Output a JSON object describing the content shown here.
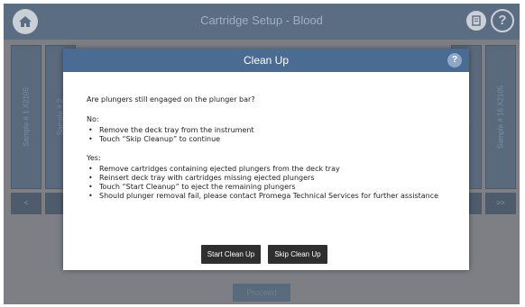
{
  "app": {
    "title": "Cartridge Setup - Blood",
    "proceed_label": "Proceed"
  },
  "icons": {
    "home": "home-icon",
    "notes": "notes-icon",
    "help": "help-icon"
  },
  "lanes": {
    "left": [
      "Sample # 1 X2105",
      "Sample # 2"
    ],
    "right": [
      "Sample # 15",
      "Sample # 16 X2105"
    ],
    "left_buttons": [
      "<",
      ""
    ],
    "right_buttons": [
      "",
      ">>"
    ]
  },
  "dialog": {
    "title": "Clean Up",
    "help_glyph": "?",
    "question": "Are plungers still engaged on the plunger bar?",
    "no_label": "No:",
    "no_items": [
      "Remove the deck tray from the instrument",
      "Touch “Skip Cleanup” to continue"
    ],
    "yes_label": "Yes:",
    "yes_items": [
      "Remove cartridges containing ejected plungers from the deck tray",
      "Reinsert deck tray  with cartridges missing ejected plungers",
      "Touch “Start Cleanup” to eject the remaining plungers",
      "Should plunger removal fail, please contact Promega Technical Services for further assistance"
    ],
    "start_button": "Start Clean Up",
    "skip_button": "Skip Clean Up"
  },
  "colors": {
    "dialog_header": "#4a6b92",
    "top_bar": "#5b6d82",
    "button": "#2f2f2f"
  }
}
